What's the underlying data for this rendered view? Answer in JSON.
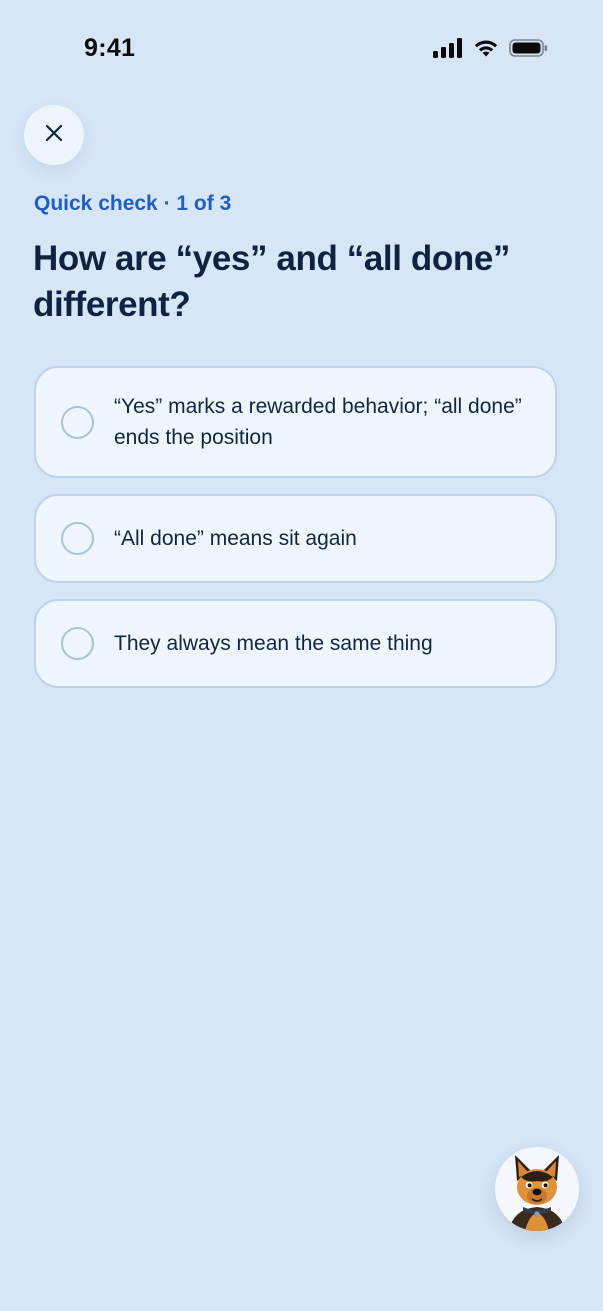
{
  "status_bar": {
    "time": "9:41",
    "icons": [
      "cellular-signal-icon",
      "wifi-icon",
      "battery-icon"
    ]
  },
  "close_button": {
    "icon": "close-icon"
  },
  "quiz": {
    "eyebrow": "Quick check · 1 of 3",
    "question": "How are “yes” and “all done” different?",
    "options": [
      {
        "label": "“Yes” marks a rewarded behavior; “all done” ends the position",
        "selected": false
      },
      {
        "label": "“All done” means sit again",
        "selected": false
      },
      {
        "label": "They always mean the same thing",
        "selected": false
      }
    ]
  },
  "mascot": {
    "icon": "dog-mascot-avatar"
  },
  "colors": {
    "background": "#d6e6f7",
    "accent": "#1f5fbf",
    "option_bg": "#eef5fd",
    "option_border": "#bcd3ea",
    "text": "#0f2340"
  }
}
